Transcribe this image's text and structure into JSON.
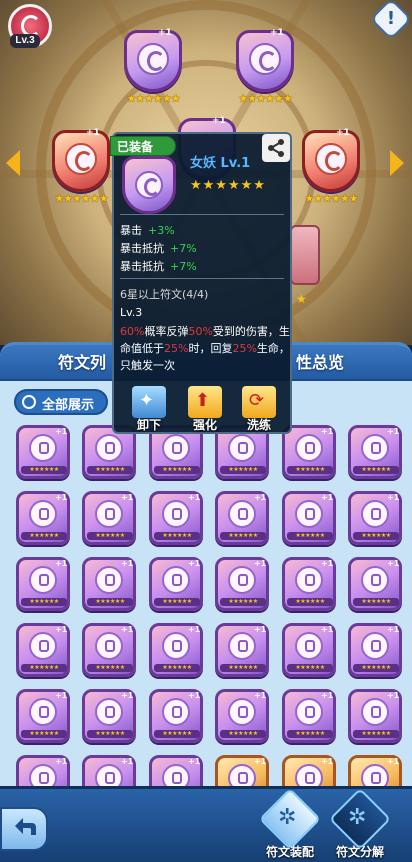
{
  "colors": {
    "accent_blue": "#2a6ebd",
    "star_gold": "#f5c518",
    "equipped_green": "#2e9a3c",
    "stat_green": "#38d34a",
    "highlight_red": "#e13838",
    "name_blue": "#58b7ff"
  },
  "top": {
    "level": "Lv.3",
    "help": "!",
    "slots": [
      {
        "plus": "+1",
        "stars": "★★★★★★"
      },
      {
        "plus": "+1",
        "stars": "★★★★★★"
      },
      {
        "plus": "+1",
        "stars": "★★★★★★"
      },
      {
        "plus": "+1",
        "stars": "★★★★★★"
      },
      {
        "plus": "+1",
        "stars": "★★★★★★"
      }
    ],
    "lower_stars": "★"
  },
  "tooltip": {
    "equipped": "已装备",
    "name": "女妖 Lv.1",
    "stars": "★★★★★★",
    "stats": [
      {
        "label": "暴击",
        "value": "+3%"
      },
      {
        "label": "暴击抵抗",
        "value": "+7%"
      },
      {
        "label": "暴击抵抗",
        "value": "+7%"
      }
    ],
    "set_title": "6星以上符文(4/4)",
    "set_level": "Lv.3",
    "desc": {
      "p1": "60%",
      "t1": "概率反弹",
      "p2": "50%",
      "t2": "受到的伤害，生命值低于",
      "p3": "25%",
      "t3": "时，回复",
      "p4": "25%",
      "t4": "生命，只触发一次"
    },
    "buttons": {
      "unequip": "卸下",
      "enhance": "强化",
      "reforge": "洗练"
    }
  },
  "panel": {
    "tab_left": "符文列",
    "tab_right": "性总览",
    "show_all": "全部展示",
    "rune_plus": "+1",
    "rune_stars": "★★★★★★"
  },
  "bottom": {
    "equip": "符文装配",
    "decompose": "符文分解"
  }
}
